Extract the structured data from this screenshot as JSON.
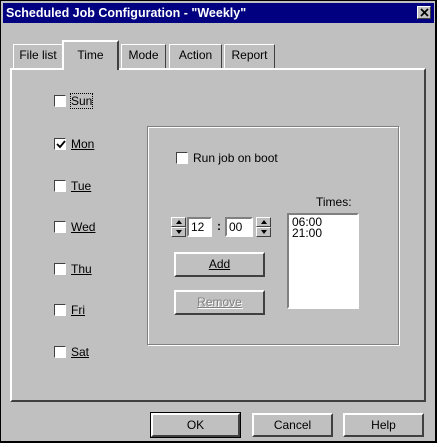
{
  "window": {
    "title": "Scheduled Job Configuration - \"Weekly\"",
    "colors": {
      "face": "#c0c0c0",
      "titlebar": "#000080",
      "title_text": "#ffffff"
    }
  },
  "tabs": [
    {
      "label": "File list",
      "active": false
    },
    {
      "label": "Time",
      "active": true
    },
    {
      "label": "Mode",
      "active": false
    },
    {
      "label": "Action",
      "active": false
    },
    {
      "label": "Report",
      "active": false
    }
  ],
  "days": [
    {
      "label": "Sun",
      "checked": false
    },
    {
      "label": "Mon",
      "checked": true
    },
    {
      "label": "Tue",
      "checked": false
    },
    {
      "label": "Wed",
      "checked": false
    },
    {
      "label": "Thu",
      "checked": false
    },
    {
      "label": "Fri",
      "checked": false
    },
    {
      "label": "Sat",
      "checked": false
    }
  ],
  "run_on_boot": {
    "label": "Run job on boot",
    "checked": false
  },
  "time_entry": {
    "hour": "12",
    "separator": ":",
    "minute": "00"
  },
  "buttons": {
    "add": "Add",
    "remove": "Remove",
    "ok": "OK",
    "cancel": "Cancel",
    "help": "Help"
  },
  "times": {
    "label": "Times:",
    "items": [
      "06:00",
      "21:00"
    ]
  },
  "icons": {
    "close": "close-icon",
    "check": "check-icon",
    "spin_up": "arrow-up-icon",
    "spin_down": "arrow-down-icon"
  }
}
